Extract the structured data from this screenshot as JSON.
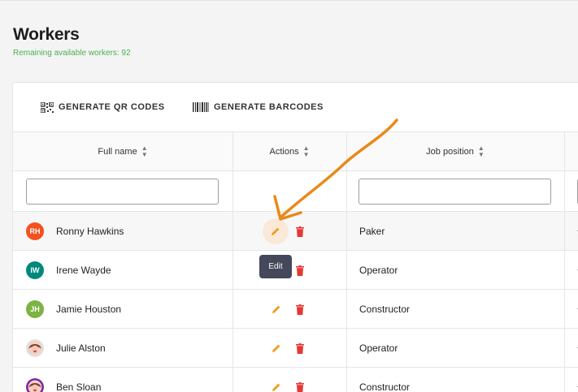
{
  "page": {
    "title": "Workers",
    "subtitle": "Remaining available workers: 92"
  },
  "toolbar": {
    "qr_label": "GENERATE QR CODES",
    "barcode_label": "GENERATE BARCODES"
  },
  "table": {
    "headers": {
      "name": "Full name",
      "actions": "Actions",
      "job": "Job position"
    },
    "filters": {
      "name": "",
      "job": ""
    },
    "rows": [
      {
        "initials": "RH",
        "name": "Ronny Hawkins",
        "job": "Paker",
        "avatar_color": "#f4511e"
      },
      {
        "initials": "IW",
        "name": "Irene Wayde",
        "job": "Operator",
        "avatar_color": "#00897b"
      },
      {
        "initials": "JH",
        "name": "Jamie Houston",
        "job": "Constructor",
        "avatar_color": "#7cb342"
      },
      {
        "initials": "",
        "name": "Julie Alston",
        "job": "Operator",
        "avatar_color": "#e0e0e0"
      },
      {
        "initials": "",
        "name": "Ben Sloan",
        "job": "Constructor",
        "avatar_color": "#7b1fa2"
      }
    ]
  },
  "tooltip": {
    "text": "Edit"
  },
  "icons": {
    "qr": "qr-code-icon",
    "barcode": "barcode-icon",
    "sort": "sort-icon",
    "edit": "pencil-icon",
    "delete": "trash-icon"
  },
  "colors": {
    "accent": "#f39a1e",
    "delete": "#e53935",
    "subtitle": "#4caf50",
    "tooltip": "#44485a",
    "arrow": "#e88a1a"
  }
}
